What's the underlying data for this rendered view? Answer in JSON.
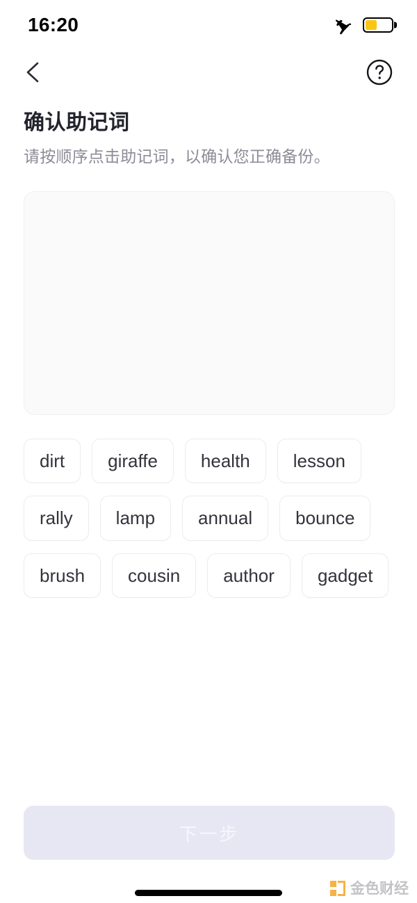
{
  "status_bar": {
    "time": "16:20",
    "airplane_icon": "airplane-mode-icon",
    "battery_icon": "battery-low-power-icon",
    "battery_level_percent": 44,
    "battery_fill_color": "#f9c613"
  },
  "nav_bar": {
    "back_icon": "chevron-left-icon",
    "help_icon": "question-mark-circle-icon"
  },
  "heading": {
    "title": "确认助记词",
    "subtitle": "请按顺序点击助记词，以确认您正确备份。"
  },
  "answer_area": {
    "selected_words": [],
    "background_color": "#fafafb"
  },
  "word_pool": {
    "words": [
      "dirt",
      "giraffe",
      "health",
      "lesson",
      "rally",
      "lamp",
      "annual",
      "bounce",
      "brush",
      "cousin",
      "author",
      "gadget"
    ]
  },
  "cta": {
    "label": "下一步",
    "disabled": true,
    "background_color": "#e7e7f4",
    "text_color": "#f6f6fb"
  },
  "watermark": {
    "text": "金色财经",
    "mark_color": "#f5a623"
  }
}
